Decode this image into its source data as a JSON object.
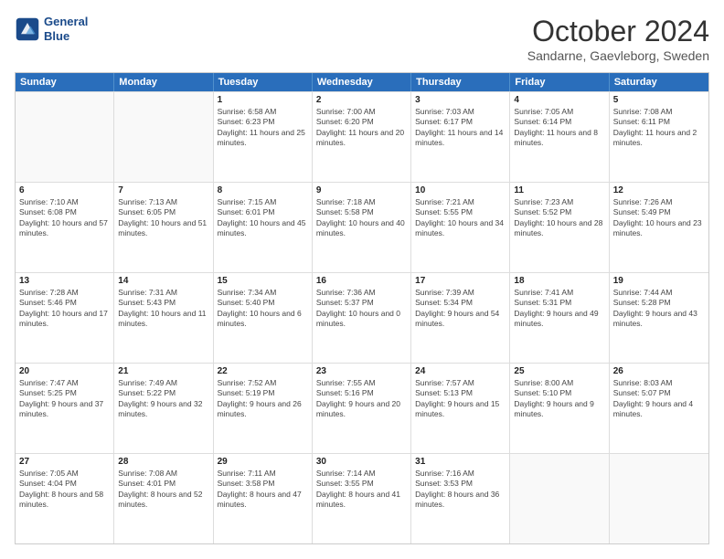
{
  "logo": {
    "line1": "General",
    "line2": "Blue"
  },
  "title": "October 2024",
  "subtitle": "Sandarne, Gaevleborg, Sweden",
  "headers": [
    "Sunday",
    "Monday",
    "Tuesday",
    "Wednesday",
    "Thursday",
    "Friday",
    "Saturday"
  ],
  "rows": [
    [
      {
        "day": "",
        "sunrise": "",
        "sunset": "",
        "daylight": "",
        "empty": true
      },
      {
        "day": "",
        "sunrise": "",
        "sunset": "",
        "daylight": "",
        "empty": true
      },
      {
        "day": "1",
        "sunrise": "Sunrise: 6:58 AM",
        "sunset": "Sunset: 6:23 PM",
        "daylight": "Daylight: 11 hours and 25 minutes."
      },
      {
        "day": "2",
        "sunrise": "Sunrise: 7:00 AM",
        "sunset": "Sunset: 6:20 PM",
        "daylight": "Daylight: 11 hours and 20 minutes."
      },
      {
        "day": "3",
        "sunrise": "Sunrise: 7:03 AM",
        "sunset": "Sunset: 6:17 PM",
        "daylight": "Daylight: 11 hours and 14 minutes."
      },
      {
        "day": "4",
        "sunrise": "Sunrise: 7:05 AM",
        "sunset": "Sunset: 6:14 PM",
        "daylight": "Daylight: 11 hours and 8 minutes."
      },
      {
        "day": "5",
        "sunrise": "Sunrise: 7:08 AM",
        "sunset": "Sunset: 6:11 PM",
        "daylight": "Daylight: 11 hours and 2 minutes."
      }
    ],
    [
      {
        "day": "6",
        "sunrise": "Sunrise: 7:10 AM",
        "sunset": "Sunset: 6:08 PM",
        "daylight": "Daylight: 10 hours and 57 minutes."
      },
      {
        "day": "7",
        "sunrise": "Sunrise: 7:13 AM",
        "sunset": "Sunset: 6:05 PM",
        "daylight": "Daylight: 10 hours and 51 minutes."
      },
      {
        "day": "8",
        "sunrise": "Sunrise: 7:15 AM",
        "sunset": "Sunset: 6:01 PM",
        "daylight": "Daylight: 10 hours and 45 minutes."
      },
      {
        "day": "9",
        "sunrise": "Sunrise: 7:18 AM",
        "sunset": "Sunset: 5:58 PM",
        "daylight": "Daylight: 10 hours and 40 minutes."
      },
      {
        "day": "10",
        "sunrise": "Sunrise: 7:21 AM",
        "sunset": "Sunset: 5:55 PM",
        "daylight": "Daylight: 10 hours and 34 minutes."
      },
      {
        "day": "11",
        "sunrise": "Sunrise: 7:23 AM",
        "sunset": "Sunset: 5:52 PM",
        "daylight": "Daylight: 10 hours and 28 minutes."
      },
      {
        "day": "12",
        "sunrise": "Sunrise: 7:26 AM",
        "sunset": "Sunset: 5:49 PM",
        "daylight": "Daylight: 10 hours and 23 minutes."
      }
    ],
    [
      {
        "day": "13",
        "sunrise": "Sunrise: 7:28 AM",
        "sunset": "Sunset: 5:46 PM",
        "daylight": "Daylight: 10 hours and 17 minutes."
      },
      {
        "day": "14",
        "sunrise": "Sunrise: 7:31 AM",
        "sunset": "Sunset: 5:43 PM",
        "daylight": "Daylight: 10 hours and 11 minutes."
      },
      {
        "day": "15",
        "sunrise": "Sunrise: 7:34 AM",
        "sunset": "Sunset: 5:40 PM",
        "daylight": "Daylight: 10 hours and 6 minutes."
      },
      {
        "day": "16",
        "sunrise": "Sunrise: 7:36 AM",
        "sunset": "Sunset: 5:37 PM",
        "daylight": "Daylight: 10 hours and 0 minutes."
      },
      {
        "day": "17",
        "sunrise": "Sunrise: 7:39 AM",
        "sunset": "Sunset: 5:34 PM",
        "daylight": "Daylight: 9 hours and 54 minutes."
      },
      {
        "day": "18",
        "sunrise": "Sunrise: 7:41 AM",
        "sunset": "Sunset: 5:31 PM",
        "daylight": "Daylight: 9 hours and 49 minutes."
      },
      {
        "day": "19",
        "sunrise": "Sunrise: 7:44 AM",
        "sunset": "Sunset: 5:28 PM",
        "daylight": "Daylight: 9 hours and 43 minutes."
      }
    ],
    [
      {
        "day": "20",
        "sunrise": "Sunrise: 7:47 AM",
        "sunset": "Sunset: 5:25 PM",
        "daylight": "Daylight: 9 hours and 37 minutes."
      },
      {
        "day": "21",
        "sunrise": "Sunrise: 7:49 AM",
        "sunset": "Sunset: 5:22 PM",
        "daylight": "Daylight: 9 hours and 32 minutes."
      },
      {
        "day": "22",
        "sunrise": "Sunrise: 7:52 AM",
        "sunset": "Sunset: 5:19 PM",
        "daylight": "Daylight: 9 hours and 26 minutes."
      },
      {
        "day": "23",
        "sunrise": "Sunrise: 7:55 AM",
        "sunset": "Sunset: 5:16 PM",
        "daylight": "Daylight: 9 hours and 20 minutes."
      },
      {
        "day": "24",
        "sunrise": "Sunrise: 7:57 AM",
        "sunset": "Sunset: 5:13 PM",
        "daylight": "Daylight: 9 hours and 15 minutes."
      },
      {
        "day": "25",
        "sunrise": "Sunrise: 8:00 AM",
        "sunset": "Sunset: 5:10 PM",
        "daylight": "Daylight: 9 hours and 9 minutes."
      },
      {
        "day": "26",
        "sunrise": "Sunrise: 8:03 AM",
        "sunset": "Sunset: 5:07 PM",
        "daylight": "Daylight: 9 hours and 4 minutes."
      }
    ],
    [
      {
        "day": "27",
        "sunrise": "Sunrise: 7:05 AM",
        "sunset": "Sunset: 4:04 PM",
        "daylight": "Daylight: 8 hours and 58 minutes."
      },
      {
        "day": "28",
        "sunrise": "Sunrise: 7:08 AM",
        "sunset": "Sunset: 4:01 PM",
        "daylight": "Daylight: 8 hours and 52 minutes."
      },
      {
        "day": "29",
        "sunrise": "Sunrise: 7:11 AM",
        "sunset": "Sunset: 3:58 PM",
        "daylight": "Daylight: 8 hours and 47 minutes."
      },
      {
        "day": "30",
        "sunrise": "Sunrise: 7:14 AM",
        "sunset": "Sunset: 3:55 PM",
        "daylight": "Daylight: 8 hours and 41 minutes."
      },
      {
        "day": "31",
        "sunrise": "Sunrise: 7:16 AM",
        "sunset": "Sunset: 3:53 PM",
        "daylight": "Daylight: 8 hours and 36 minutes."
      },
      {
        "day": "",
        "sunrise": "",
        "sunset": "",
        "daylight": "",
        "empty": true
      },
      {
        "day": "",
        "sunrise": "",
        "sunset": "",
        "daylight": "",
        "empty": true
      }
    ]
  ]
}
